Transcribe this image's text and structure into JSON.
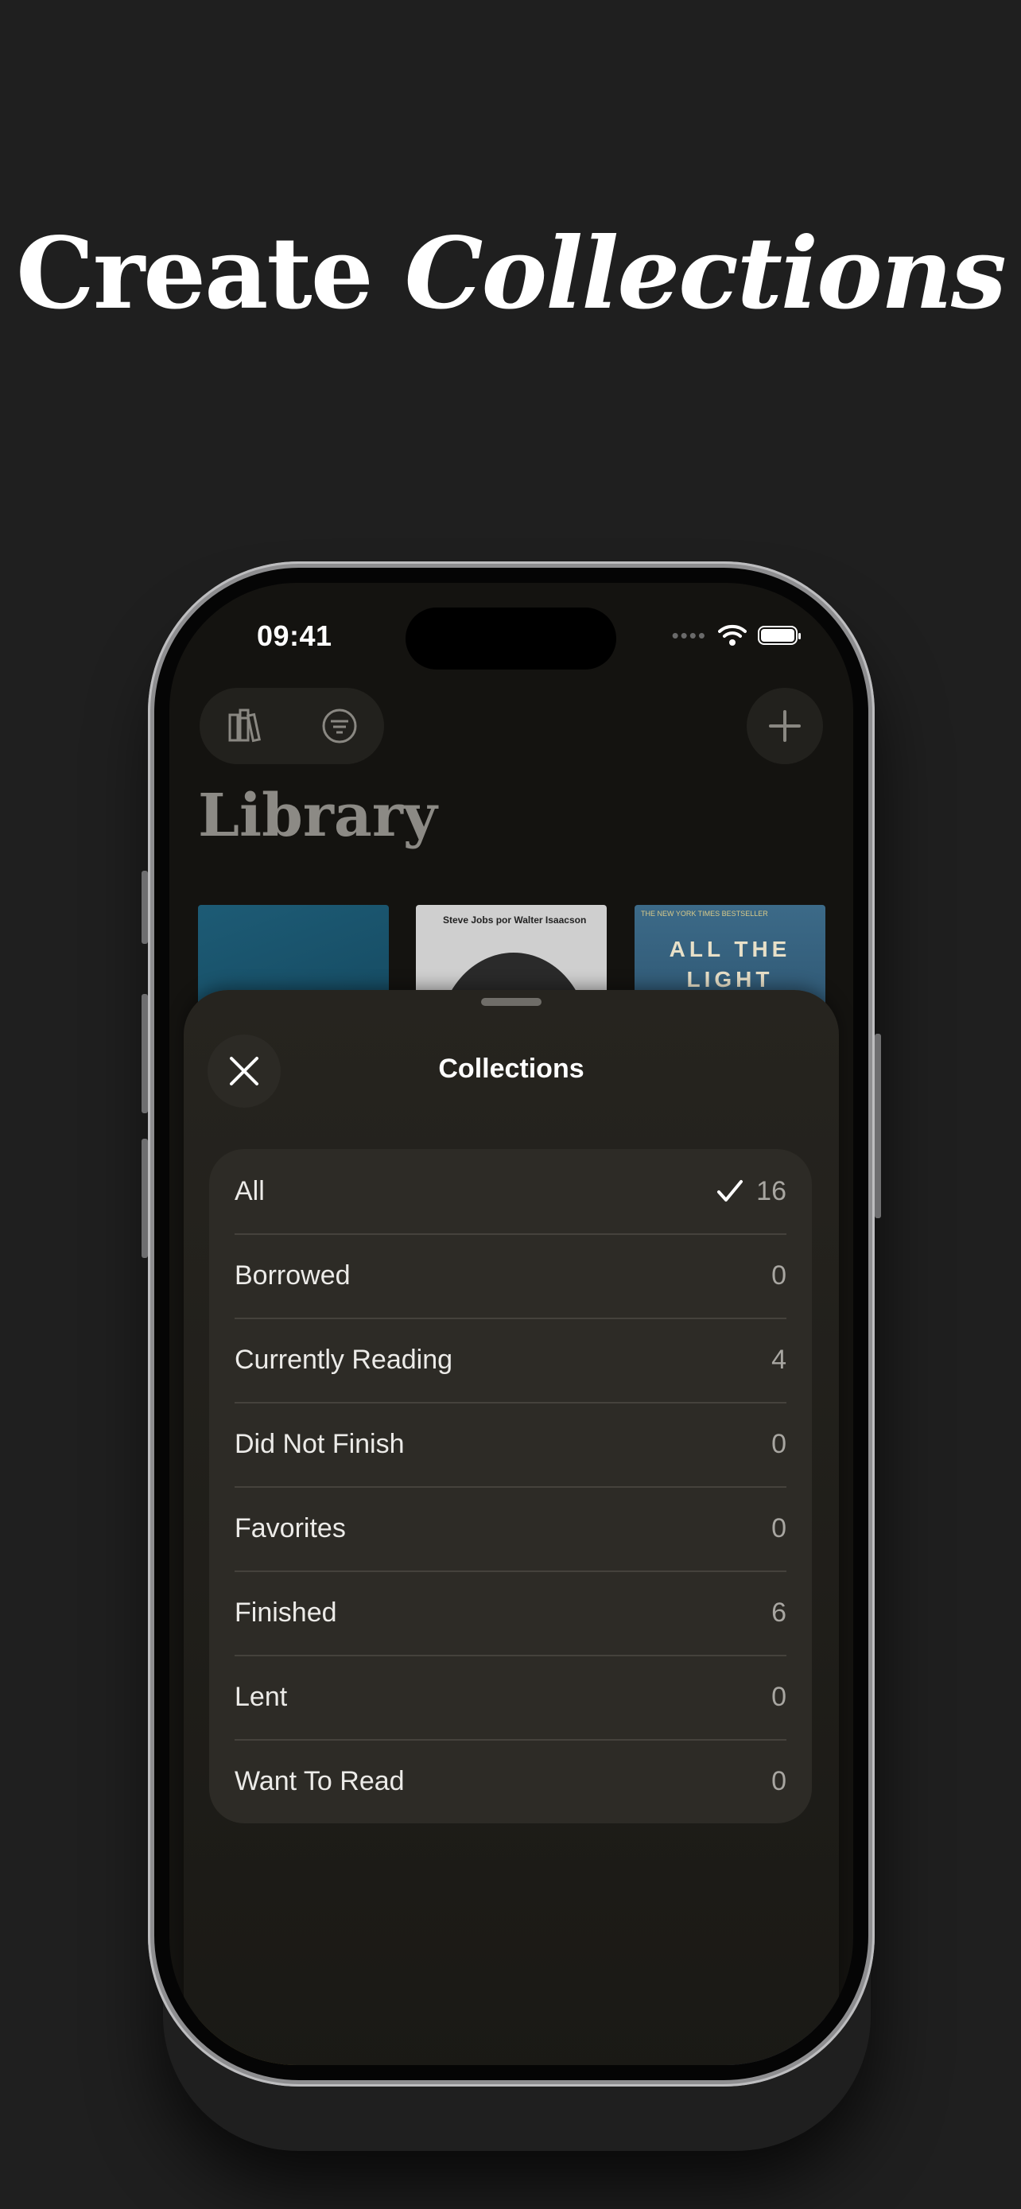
{
  "headline": {
    "regular": "Create",
    "italic": "Collections"
  },
  "status_bar": {
    "time": "09:41"
  },
  "library": {
    "title": "Library",
    "books": [
      {
        "cover_text": ""
      },
      {
        "cover_text": "Steve Jobs por Walter Isaacson"
      },
      {
        "cover_text_line1": "ALL THE",
        "cover_text_line2": "LIGHT",
        "tagline": "THE NEW YORK TIMES BESTSELLER"
      }
    ]
  },
  "sheet": {
    "title": "Collections",
    "items": [
      {
        "label": "All",
        "count": "16",
        "selected": true
      },
      {
        "label": "Borrowed",
        "count": "0"
      },
      {
        "label": "Currently Reading",
        "count": "4"
      },
      {
        "label": "Did Not Finish",
        "count": "0"
      },
      {
        "label": "Favorites",
        "count": "0"
      },
      {
        "label": "Finished",
        "count": "6"
      },
      {
        "label": "Lent",
        "count": "0"
      },
      {
        "label": "Want To Read",
        "count": "0"
      }
    ]
  },
  "icons": [
    "bookshelf-icon",
    "filter-icon",
    "plus-icon",
    "close-icon",
    "checkmark-icon",
    "wifi-icon",
    "battery-icon"
  ]
}
